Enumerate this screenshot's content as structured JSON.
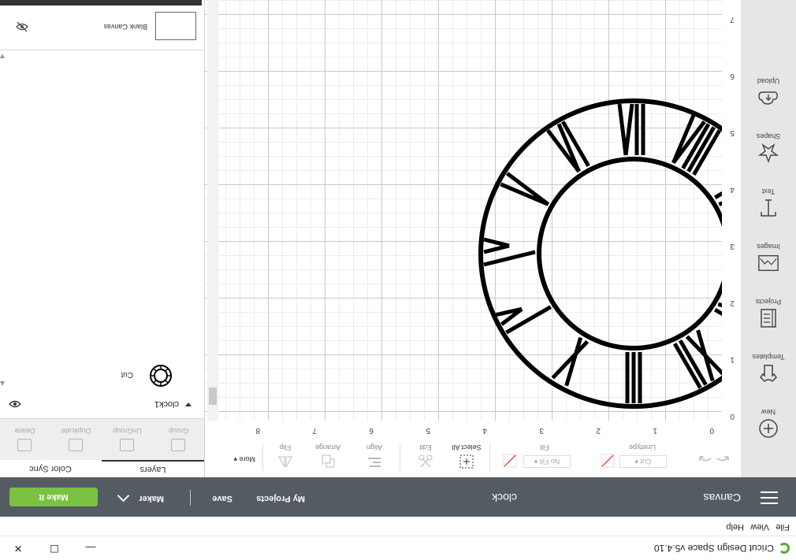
{
  "window": {
    "title": "Cricut Design Space  v5.4.10",
    "controls": [
      "minimize",
      "maximize",
      "close"
    ]
  },
  "menu": {
    "items": [
      "File",
      "View",
      "Help"
    ]
  },
  "header": {
    "canvas_label": "Canvas",
    "project_name": "clock",
    "my_projects": "My Projects",
    "save": "Save",
    "separator": "|",
    "maker": "Maker",
    "make_it": "Make It"
  },
  "left_tools": [
    {
      "label": "New",
      "icon": "plus-circle-icon"
    },
    {
      "label": "Templates",
      "icon": "shirt-icon"
    },
    {
      "label": "Projects",
      "icon": "projects-icon"
    },
    {
      "label": "Images",
      "icon": "image-icon"
    },
    {
      "label": "Text",
      "icon": "text-icon"
    },
    {
      "label": "Shapes",
      "icon": "shapes-icon"
    },
    {
      "label": "Upload",
      "icon": "upload-icon"
    }
  ],
  "toolbar": {
    "linetype_label": "Linetype",
    "linetype_value": "Cut",
    "fill_label": "Fill",
    "fill_value": "No Fill",
    "select_all": "Select All",
    "edit": "Edit",
    "align": "Align",
    "arrange": "Arrange",
    "flip": "Flip",
    "more": "More"
  },
  "rulers": {
    "top": [
      "0",
      "1",
      "2",
      "3",
      "4",
      "5",
      "6",
      "7",
      "8"
    ],
    "left": [
      "0",
      "1",
      "2",
      "3",
      "4",
      "5",
      "6",
      "7"
    ]
  },
  "panel": {
    "tabs": [
      "Layers",
      "Color Sync"
    ],
    "actions": [
      "Group",
      "UnGroup",
      "Duplicate",
      "Delete"
    ],
    "group_name": "clock1",
    "layer_name": "Cut",
    "blank_canvas": "Blank Canvas"
  },
  "colors": {
    "header_bg": "#545b63",
    "make_it": "#7bc142",
    "cricut_green": "#4fae32"
  }
}
